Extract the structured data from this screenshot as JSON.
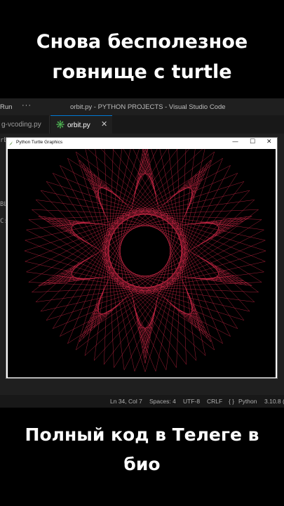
{
  "captions": {
    "top_line1": "Снова бесполезное",
    "top_line2": "говнище с turtle",
    "bottom_line1": "Полный код в Телеге в",
    "bottom_line2": "био"
  },
  "vscode": {
    "menu_run": "Run",
    "menu_more": "···",
    "window_title": "orbit.py - PYTHON PROJECTS - Visual Studio Code",
    "tabs": [
      {
        "label": "g-vcoding.py"
      },
      {
        "label": "orbit.py",
        "close": "✕"
      }
    ],
    "side_fragments": [
      "rbit",
      "BL",
      "C:"
    ],
    "status": {
      "position": "Ln 34, Col 7",
      "spaces": "Spaces: 4",
      "encoding": "UTF-8",
      "eol": "CRLF",
      "language": "Python",
      "version": "3.10.8 ("
    },
    "colors": {
      "accent": "#0078d4",
      "python_icon": "#4caf50"
    }
  },
  "turtle_window": {
    "title": "Python Turtle Graphics",
    "minimize": "—",
    "maximize": "☐",
    "close": "✕",
    "line_color": "#d92a4a",
    "background": "#000000"
  }
}
